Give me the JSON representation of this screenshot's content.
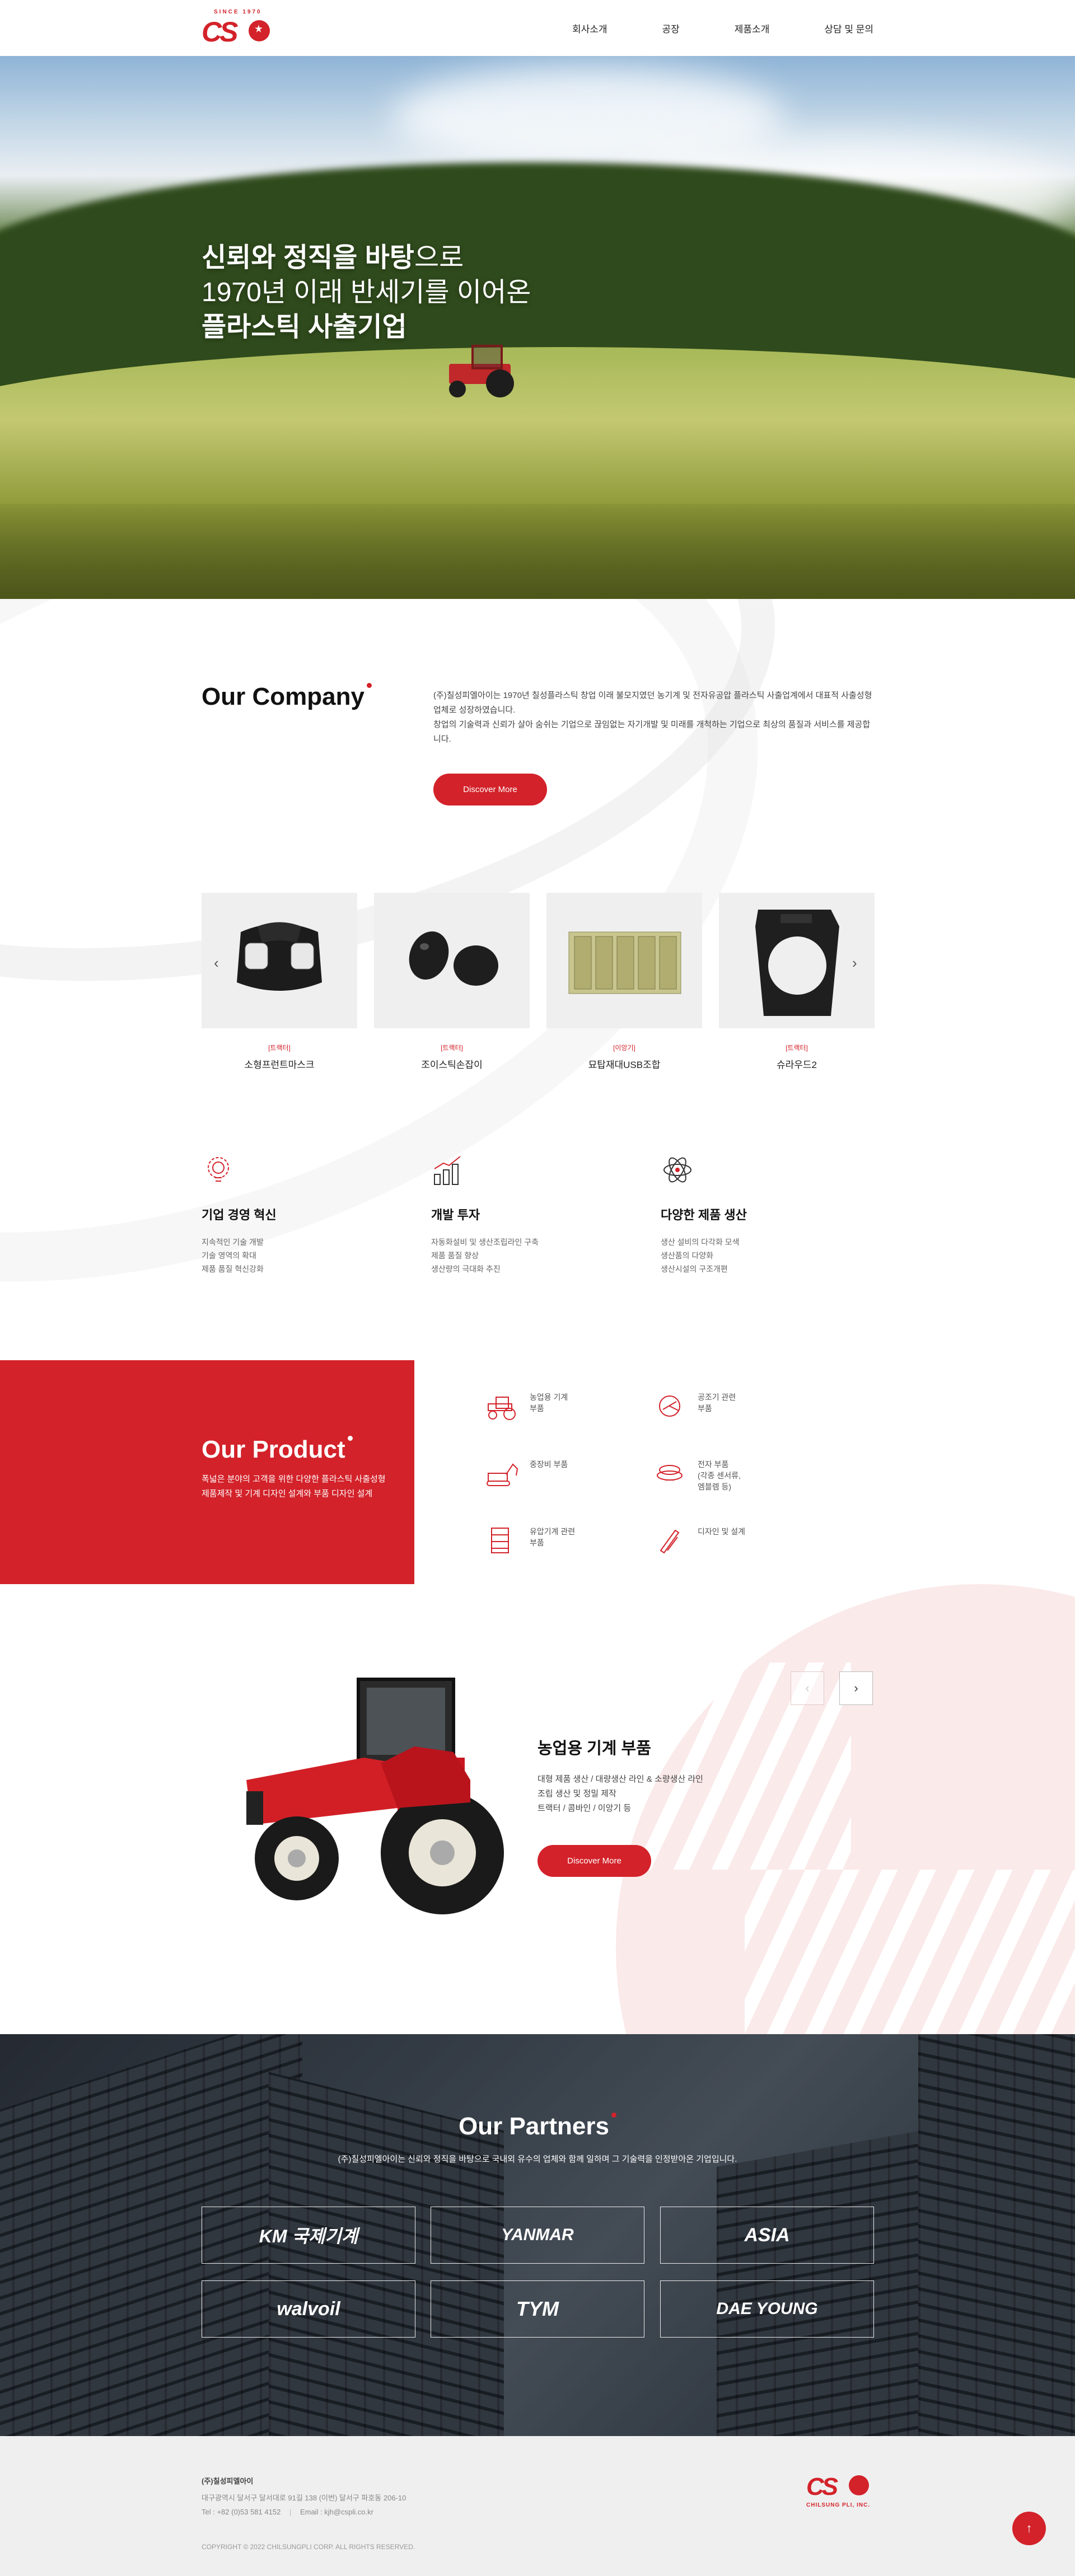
{
  "header": {
    "logo_since": "SINCE 1970",
    "logo_text": "CS",
    "nav": [
      "회사소개",
      "공장",
      "제품소개",
      "상담 및 문의"
    ]
  },
  "hero": {
    "line1_bold": "신뢰와 정직을 바탕",
    "line1_rest": "으로",
    "line2": "1970년 이래 반세기를 이어온",
    "line3": "플라스틱 사출기업"
  },
  "company": {
    "title": "Our Company",
    "desc1": "(주)칠성피엘아이는 1970년 칠성플라스틱 창업 이래 불모지였던 농기계 및 전자유공압 플라스틱 사출업계에서 대표적 사출성형 업체로 성장하였습니다.",
    "desc2": "창업의 기술력과 신뢰가 살아 숨쉬는 기업으로 끊임없는 자기개발 및 미래를 개척하는 기업으로 최상의 품질과 서비스를 제공합니다.",
    "button": "Discover More",
    "products": [
      {
        "category": "[트랙터]",
        "name": "소형프런트마스크"
      },
      {
        "category": "[트랙터]",
        "name": "조이스틱손잡이"
      },
      {
        "category": "[이앙기]",
        "name": "묘탑재대USB조합"
      },
      {
        "category": "[트랙터]",
        "name": "슈라우드2"
      }
    ],
    "features": [
      {
        "icon": "lightbulb-gear-icon",
        "title": "기업 경영 혁신",
        "lines": [
          "지속적인 기술 개발",
          "기술 영역의 확대",
          "제품 품질 혁신강화"
        ]
      },
      {
        "icon": "bar-chart-growth-icon",
        "title": "개발 투자",
        "lines": [
          "자동화설비 및 생산조립라인 구축",
          "제품 품질 향상",
          "생산량의 극대화 추진"
        ]
      },
      {
        "icon": "atom-icon",
        "title": "다양한 제품 생산",
        "lines": [
          "생산 설비의 다각화 모색",
          "생산품의 다양화",
          "생산시설의 구조개편"
        ]
      }
    ]
  },
  "product": {
    "title": "Our Product",
    "desc1": "폭넓은 분야의 고객을 위한 다양한 플라스틱 사출성형",
    "desc2": "제품제작 및 기계 디자인 설계와 부품 디자인 설계",
    "categories": [
      {
        "icon": "tractor-icon",
        "label": "농업용 기계\n부품"
      },
      {
        "icon": "air-blower-icon",
        "label": "공조기 관련\n부품"
      },
      {
        "icon": "excavator-icon",
        "label": "중장비 부품"
      },
      {
        "icon": "electronic-sensor-icon",
        "label": "전자 부품\n(각종 센서류,\n엠블렘 등)"
      },
      {
        "icon": "hydraulic-machine-icon",
        "label": "유압기계 관련\n부품"
      },
      {
        "icon": "design-tools-icon",
        "label": "디자인 및 설계"
      }
    ]
  },
  "slide": {
    "title": "농업용 기계 부품",
    "desc1": "대형 제품 생산 / 대량생산 라인 & 소량생산 라인",
    "desc2": "조립 생산 및 정밀 제작",
    "desc3": "트랙터 / 콤바인 / 이앙기 등",
    "button": "Discover More",
    "prev": "‹",
    "next": "›"
  },
  "partners": {
    "title": "Our Partners",
    "desc": "(주)칠성피엘아이는 신뢰와 정직을 바탕으로 국내외 유수의 업체와 함께 일하며 그 기술력을 인정받아온 기업입니다.",
    "logos": [
      "KM 국제기계",
      "YANMAR",
      "ASIA",
      "walvoil",
      "TYM",
      "DAE YOUNG"
    ]
  },
  "footer": {
    "company": "(주)칠성피엘아이",
    "address": "대구광역시 달서구 달서대로 91길 138 (이번) 달서구 파호동 206-10",
    "tel": "Tel : +82 (0)53 581 4152",
    "email": "Email : kjh@cspli.co.kr",
    "copyright": "COPYRIGHT © 2022 CHILSUNGPLI CORP. ALL RIGHTS RESERVED.",
    "logo_text": "CS",
    "logo_sub": "CHILSUNG PLI, INC.",
    "top_button": "↑"
  },
  "colors": {
    "accent": "#d3222a",
    "band_light": "#fbeaea",
    "footer_bg": "#efefef"
  }
}
